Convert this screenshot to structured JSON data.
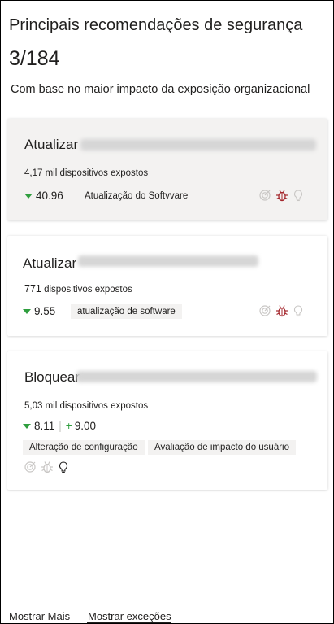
{
  "header": {
    "title": "Principais recomendações de segurança",
    "count": "3/184",
    "subtitle": "Com base no maior impacto da exposição organizacional"
  },
  "cards": [
    {
      "action": "Atualizar",
      "devices": "4,17 mil dispositivos expostos",
      "score": "40.96",
      "tags": [
        "Atualização do Softvvare"
      ],
      "selected": true
    },
    {
      "action": "Atualizar",
      "devices_count": "771",
      "devices_text": "dispositivos expostos",
      "score": "9.55",
      "tags": [
        "atualização de software"
      ]
    },
    {
      "action": "Bloquear",
      "devices": "5,03 mil dispositivos expostos",
      "score": "8.11",
      "score_plus": "9.00",
      "tags": [
        "Alteração de configuração",
        "Avaliação de impacto do usuário"
      ]
    }
  ],
  "footer": {
    "show_more": "Mostrar Mais",
    "show_exceptions": "Mostrar exceções"
  },
  "colors": {
    "decrease_green": "#2e9e3e",
    "threat_red": "#a4262c",
    "icon_grey": "#c8c6c4"
  },
  "icons": [
    "target-icon",
    "bug-icon",
    "lightbulb-icon"
  ]
}
